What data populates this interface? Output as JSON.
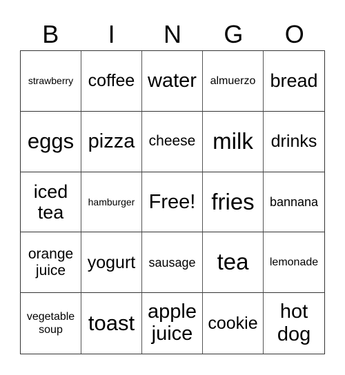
{
  "header": {
    "letters": [
      "B",
      "I",
      "N",
      "G",
      "O"
    ]
  },
  "grid": {
    "cells": [
      "strawberry",
      "coffee",
      "water",
      "almuerzo",
      "bread",
      "eggs",
      "pizza",
      "cheese",
      "milk",
      "drinks",
      "iced tea",
      "hamburger",
      "Free!",
      "fries",
      "bannana",
      "orange juice",
      "yogurt",
      "sausage",
      "tea",
      "lemonade",
      "vegetable soup",
      "toast",
      "apple juice",
      "cookie",
      "hot dog"
    ]
  }
}
